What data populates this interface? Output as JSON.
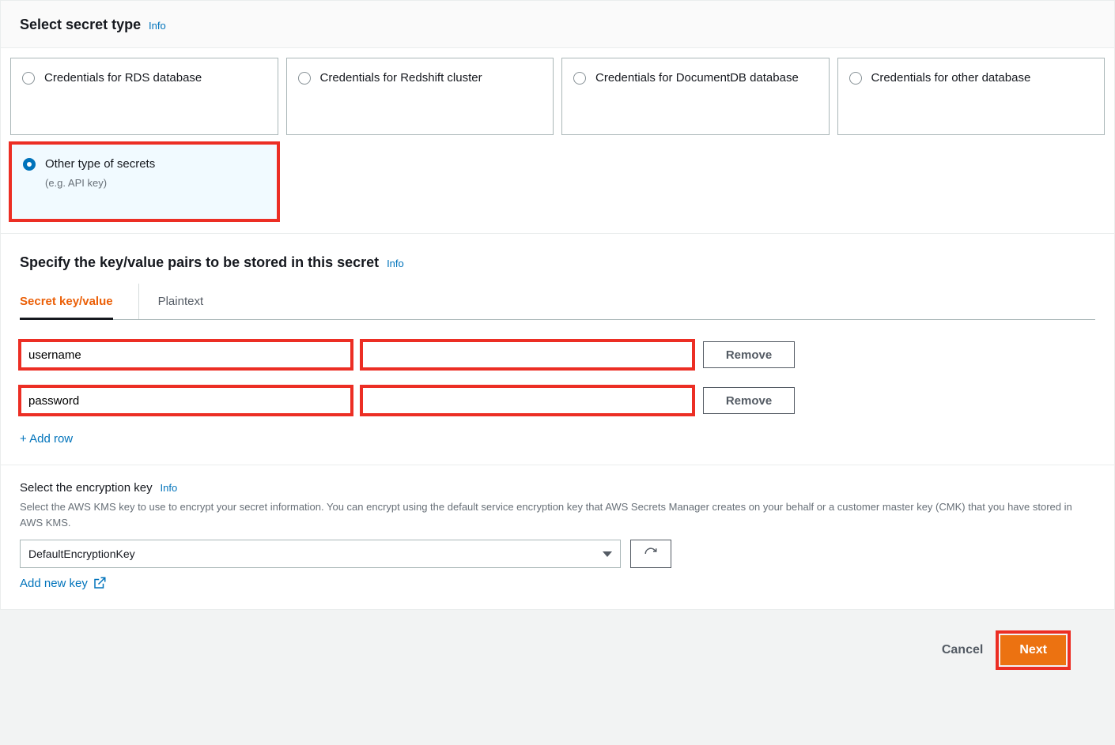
{
  "header": {
    "title": "Select secret type",
    "info": "Info"
  },
  "options": [
    {
      "label": "Credentials for RDS database",
      "sub": "",
      "selected": false
    },
    {
      "label": "Credentials for Redshift cluster",
      "sub": "",
      "selected": false
    },
    {
      "label": "Credentials for DocumentDB database",
      "sub": "",
      "selected": false
    },
    {
      "label": "Credentials for other database",
      "sub": "",
      "selected": false
    },
    {
      "label": "Other type of secrets",
      "sub": "(e.g. API key)",
      "selected": true
    }
  ],
  "kv_header": {
    "title": "Specify the key/value pairs to be stored in this secret",
    "info": "Info"
  },
  "tabs": {
    "active": "Secret key/value",
    "other": "Plaintext"
  },
  "rows": [
    {
      "key": "username",
      "value": "",
      "remove": "Remove"
    },
    {
      "key": "password",
      "value": "",
      "remove": "Remove"
    }
  ],
  "add_row": "+ Add row",
  "encryption": {
    "title": "Select the encryption key",
    "info": "Info",
    "desc": "Select the AWS KMS key to use to encrypt your secret information. You can encrypt using the default service encryption key that AWS Secrets Manager creates on your behalf or a customer master key (CMK) that you have stored in AWS KMS.",
    "selected": "DefaultEncryptionKey",
    "add_new": "Add new key"
  },
  "footer": {
    "cancel": "Cancel",
    "next": "Next"
  }
}
